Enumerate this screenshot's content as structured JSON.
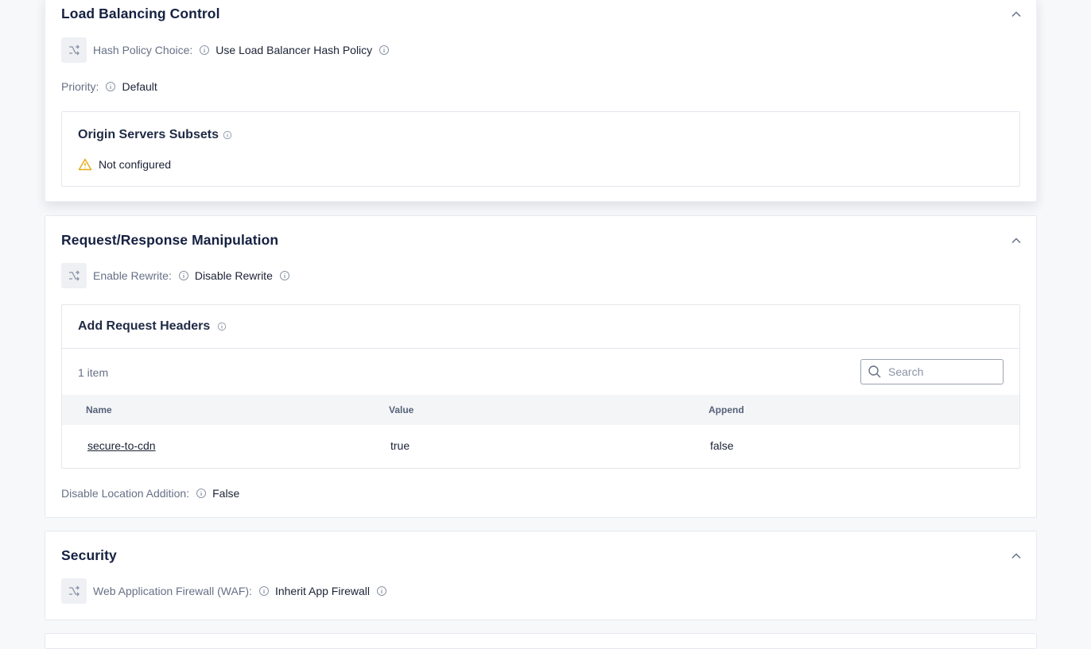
{
  "load_balancing": {
    "title": "Load Balancing Control",
    "hash_policy_label": "Hash Policy Choice:",
    "hash_policy_value": "Use Load Balancer Hash Policy",
    "priority_label": "Priority:",
    "priority_value": "Default",
    "origin_subsets_title": "Origin Servers Subsets",
    "origin_subsets_status": "Not configured"
  },
  "request_response": {
    "title": "Request/Response Manipulation",
    "enable_rewrite_label": "Enable Rewrite:",
    "enable_rewrite_value": "Disable Rewrite",
    "add_request_headers": {
      "title": "Add Request Headers",
      "count": "1 item",
      "search_placeholder": "Search",
      "columns": [
        "Name",
        "Value",
        "Append"
      ],
      "rows": [
        {
          "name": "secure-to-cdn",
          "value": "true",
          "append": "false"
        }
      ]
    },
    "disable_location_label": "Disable Location Addition:",
    "disable_location_value": "False"
  },
  "security": {
    "title": "Security",
    "waf_label": "Web Application Firewall (WAF):",
    "waf_value": "Inherit App Firewall"
  },
  "colors": {
    "warning": "#e5a912",
    "heading": "#152041",
    "muted": "#667085"
  }
}
